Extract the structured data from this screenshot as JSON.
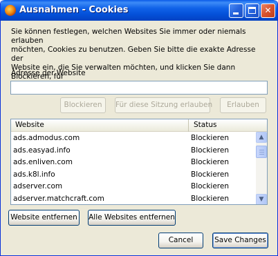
{
  "window": {
    "title": "Ausnahmen - Cookies",
    "minimize_label": "",
    "maximize_label": "",
    "close_label": "✕"
  },
  "description": "Sie können festlegen, welchen Websites Sie immer oder niemals erlauben\nmöchten, Cookies zu benutzen. Geben Sie bitte die exakte Adresse der\nWebsite ein, die Sie verwalten möchten, und klicken Sie dann Blockieren, für\ndiese Sitzung erlauben oder Erlauben.",
  "address": {
    "label": "Adresse der Website",
    "value": ""
  },
  "actions": {
    "block": "Blockieren",
    "session": "Für diese Sitzung erlauben",
    "allow": "Erlauben"
  },
  "table": {
    "columns": [
      "Website",
      "Status"
    ],
    "rows": [
      {
        "site": "ads.admodus.com",
        "status": "Blockieren"
      },
      {
        "site": "ads.easyad.info",
        "status": "Blockieren"
      },
      {
        "site": "ads.enliven.com",
        "status": "Blockieren"
      },
      {
        "site": "ads.k8l.info",
        "status": "Blockieren"
      },
      {
        "site": "adserver.com",
        "status": "Blockieren"
      },
      {
        "site": "adserver.matchcraft.com",
        "status": "Blockieren"
      }
    ]
  },
  "remove": {
    "remove_site": "Website entfernen",
    "remove_all": "Alle Websites entfernen"
  },
  "footer": {
    "cancel": "Cancel",
    "save": "Save Changes"
  },
  "icons": {
    "app": "firefox-icon",
    "minimize": "minimize-icon",
    "maximize": "maximize-icon",
    "close": "close-icon",
    "scroll_up": "chevron-up-icon",
    "scroll_down": "chevron-down-icon"
  },
  "colors": {
    "titlebar": "#0450d8",
    "dialog_bg": "#ece9d8",
    "close_button": "#d8532e"
  }
}
